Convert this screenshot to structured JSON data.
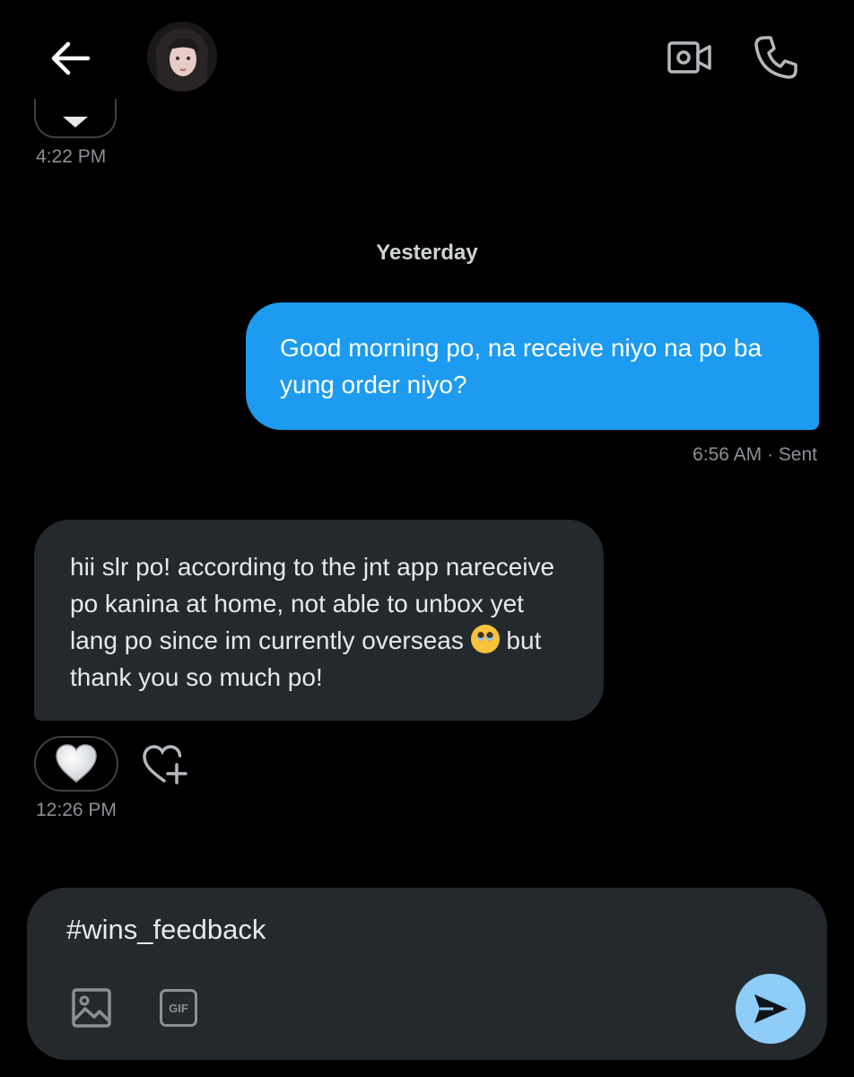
{
  "header": {
    "back_icon": "arrow-left-icon",
    "video_icon": "video-camera-icon",
    "call_icon": "phone-icon"
  },
  "messages": {
    "top_timestamp": "4:22 PM",
    "day_separator": "Yesterday",
    "sent": {
      "text": "Good morning po, na receive niyo na po ba yung order niyo?",
      "meta": "6:56 AM · Sent"
    },
    "received": {
      "text_before_emoji": "hii slr po! according to the jnt app nareceive po kanina at home, not able to unbox yet lang po since im currently overseas ",
      "emoji": "pleading-face-emoji",
      "text_after_emoji": " but thank you so much po!",
      "reaction": "white-heart",
      "timestamp": "12:26 PM"
    }
  },
  "composer": {
    "value": "#wins_feedback",
    "gif_label": "GIF",
    "send_icon": "send-icon"
  },
  "colors": {
    "background": "#000000",
    "sent_bubble": "#1d9bf0",
    "received_bubble": "#24292e",
    "send_button": "#8ecdf8"
  }
}
